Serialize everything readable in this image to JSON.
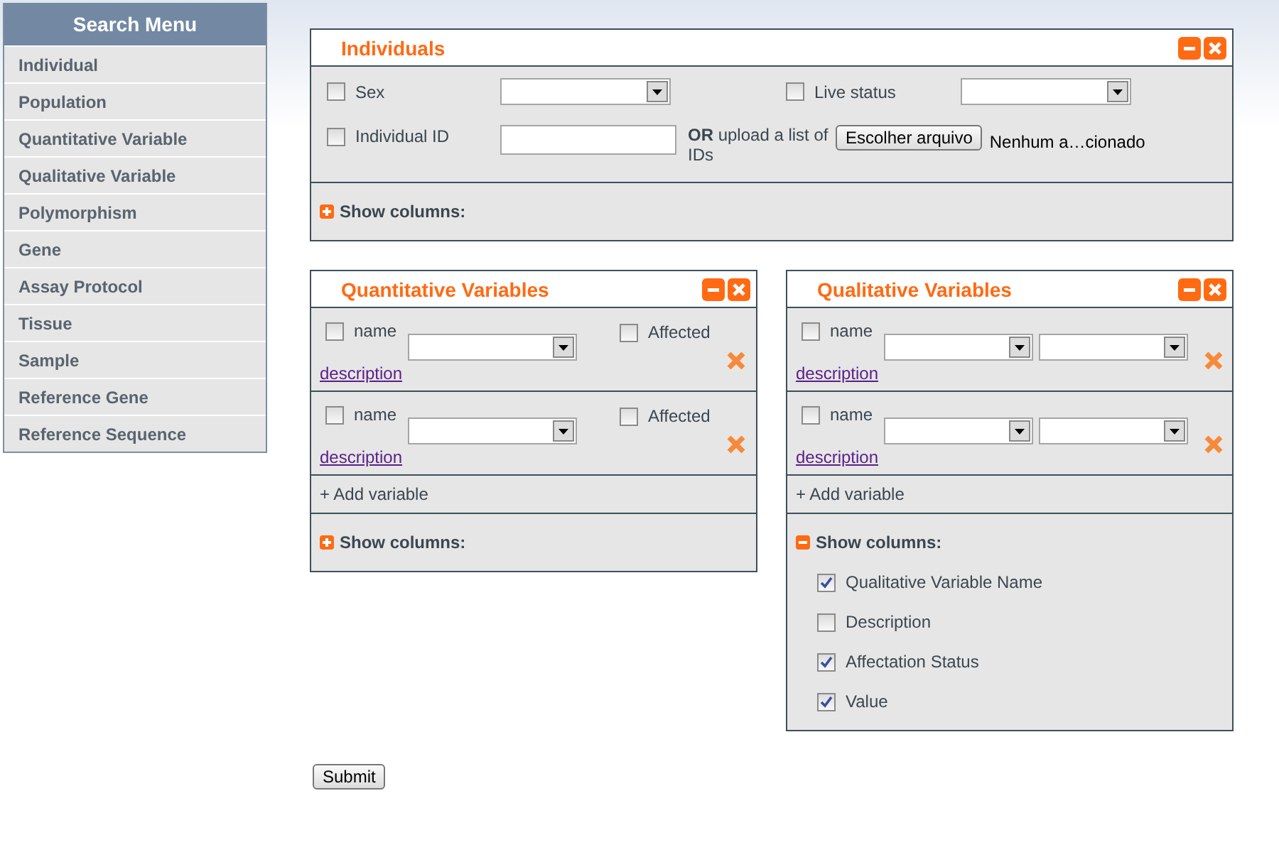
{
  "sidebar": {
    "title": "Search Menu",
    "items": [
      {
        "label": "Individual"
      },
      {
        "label": "Population"
      },
      {
        "label": "Quantitative Variable"
      },
      {
        "label": "Qualitative Variable"
      },
      {
        "label": "Polymorphism"
      },
      {
        "label": "Gene"
      },
      {
        "label": "Assay Protocol"
      },
      {
        "label": "Tissue"
      },
      {
        "label": "Sample"
      },
      {
        "label": "Reference Gene"
      },
      {
        "label": "Reference Sequence"
      }
    ]
  },
  "individuals": {
    "title": "Individuals",
    "sex": {
      "label": "Sex",
      "checked": false
    },
    "live_status": {
      "label": "Live status",
      "checked": false
    },
    "individual_id": {
      "label": "Individual ID",
      "checked": false
    },
    "upload_text": "**OR** upload a list of IDs",
    "file_button": "Escolher arquivo",
    "file_name": "Nenhum a…cionado",
    "show_columns": {
      "label": "Show columns:",
      "expanded": false
    }
  },
  "quantitative": {
    "title": "Quantitative Variables",
    "variables": [
      {
        "name_label": "name",
        "checked": false,
        "affected_label": "Affected",
        "affected": false,
        "description": "description"
      },
      {
        "name_label": "name",
        "checked": false,
        "affected_label": "Affected",
        "affected": false,
        "description": "description"
      }
    ],
    "add_variable": "+ Add variable",
    "show_columns": {
      "label": "Show columns:",
      "expanded": false
    }
  },
  "qualitative": {
    "title": "Qualitative Variables",
    "variables": [
      {
        "name_label": "name",
        "checked": false,
        "description": "description"
      },
      {
        "name_label": "name",
        "checked": false,
        "description": "description"
      }
    ],
    "add_variable": "+ Add variable",
    "show_columns": {
      "label": "Show columns:",
      "expanded": true,
      "columns": [
        {
          "label": "Qualitative Variable Name",
          "checked": true
        },
        {
          "label": "Description",
          "checked": false
        },
        {
          "label": "Affectation Status",
          "checked": true
        },
        {
          "label": "Value",
          "checked": true
        }
      ]
    }
  },
  "submit": "Submit"
}
